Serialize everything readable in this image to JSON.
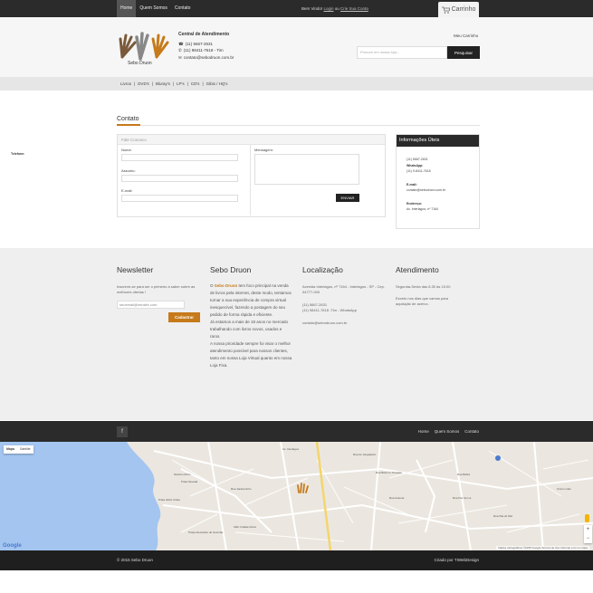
{
  "topbar": {
    "nav": [
      "Home",
      "Quem Somos",
      "Contato"
    ],
    "welcome_prefix": "Bem Vindo!",
    "login_label": "Login",
    "or_label": "ou",
    "signup_label": "Crie Sua Conta",
    "cart_label": "Carrinho"
  },
  "header": {
    "logo_text": "Sebo Druon",
    "central_title": "Central de Atendimento",
    "phone": "(11) 5667-2631",
    "whatsapp": "(11) 98411-7618 - Tim",
    "email": "contato@sebodruon.com.br",
    "my_cart": "Meu Carrinho",
    "search_placeholder": "Procure em nossa loja...",
    "search_button": "Pesquisar"
  },
  "categories": [
    "Livros",
    "DVD's",
    "Bluray's",
    "LP's",
    "CD's",
    "Gibis / HQ's"
  ],
  "page": {
    "title": "Contato"
  },
  "form": {
    "header": "Fale Conosco",
    "name_label": "Nome:",
    "subject_label": "Assunto:",
    "email_label": "E-mail:",
    "message_label": "Mensagem:",
    "send_button": "ENVIAR"
  },
  "info": {
    "title": "Informações Úteis",
    "phone_label": "Telefone:",
    "phone": "(11) 5667-2631",
    "whatsapp_label": "WhatsApp:",
    "whatsapp": "(11) 9-8411-7618",
    "email_label": "E-mail:",
    "email": "contato@sebodruon.com.br",
    "address_label": "Endereço:",
    "address": "Av. Interlagos, nº 7164"
  },
  "footer": {
    "newsletter": {
      "title": "Newsletter",
      "text": "Inscreve-se para ser o primeiro a saber sobre as melhores ofertas !",
      "input_placeholder": "seuemail@seusite.com",
      "button": "Cadastrar"
    },
    "about": {
      "title": "Sebo Druon",
      "brand": "Sebo Druon",
      "p1_pre": "O",
      "p1_post": "tem foco principal na venda de livros pela internet, deste modo, tentamos tornar a sua experiência de compra virtual inesquecível, fazendo a postagem do seu pedido de forma rápida e eficiente.",
      "p2": "Já estamos a mais de 18 anos no mercado trabalhando com livros novos, usados e raros.",
      "p3": "A nossa prioridade sempre foi visar o melhor atendimento possível para nossos clientes, tanto em nossa Loja Virtual quanto em nossa Loja Fixa."
    },
    "location": {
      "title": "Localização",
      "address": "Avenida Interlagos, nº 7164 - Interlagos - SP - Cep. 04777-000",
      "phone": "(11) 5667-2631",
      "whatsapp": "(11) 98411-7618 -Tim - WhatsApp",
      "email": "contato@sebodruon.com.br"
    },
    "hours": {
      "title": "Atendimento",
      "weekdays": "Segunda-Sexta  das 8.30 às 15.00",
      "note": "Exceto nos dias que vamos para aquisição de acervo."
    }
  },
  "bottom_nav": {
    "fb": "f",
    "links": [
      "Home",
      "Quem Somos",
      "Contato"
    ]
  },
  "map": {
    "type_map": "Mapa",
    "type_sat": "Satélite",
    "google": "Google",
    "attribution": "Dados cartográficos ©2015 Google   Termos de Uso   Informar erro no mapa",
    "streets": [
      "Praia Nevada",
      "Praia Velho Clube",
      "Nazarío Alvim",
      "Rua Grauna",
      "Rua Jacarezinho",
      "Praça Alexandre de Gusmão",
      "CEU Cidade Dutra",
      "Av. Interlagos",
      "Rua Belmiro Trindade",
      "Rua do Jangadeiro",
      "Rua Bahia",
      "Rua Ilha do Mel",
      "Cinco Lindu",
      "Rua Flor de Lis"
    ]
  },
  "copyright": {
    "left": "© 2015 Sebo Druon",
    "right": "Criado por TIWebDesign"
  },
  "colors": {
    "accent": "#c67a1a",
    "dark": "#2b2b2b"
  }
}
